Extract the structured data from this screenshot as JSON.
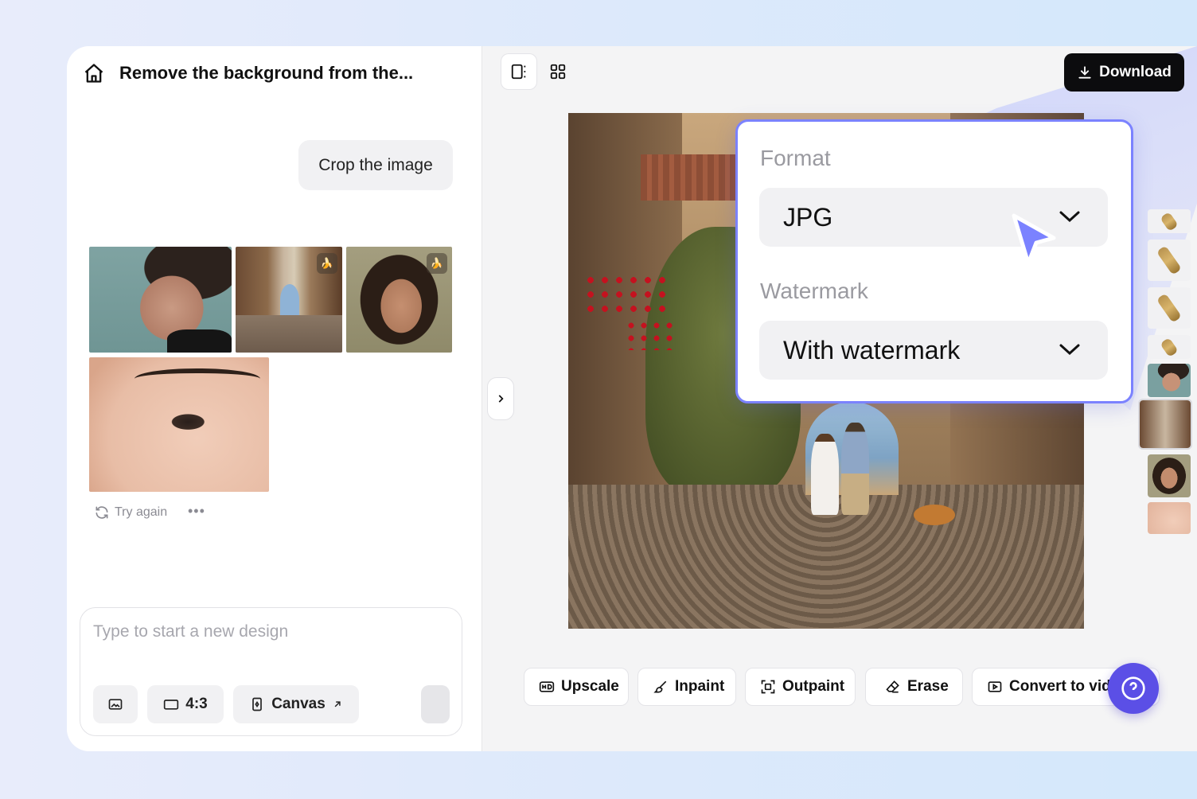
{
  "left_panel": {
    "title": "Remove the background from the...",
    "prompt_bubble": "Crop the image",
    "try_again": "Try again",
    "more": "•••",
    "composer": {
      "placeholder": "Type to start a new design",
      "ratio_label": "4:3",
      "canvas_label": "Canvas"
    }
  },
  "toolbar": {
    "download_label": "Download"
  },
  "download_popup": {
    "format_label": "Format",
    "format_value": "JPG",
    "watermark_label": "Watermark",
    "watermark_value": "With watermark"
  },
  "tools": [
    {
      "label": "Upscale",
      "icon": "hd-icon"
    },
    {
      "label": "Inpaint",
      "icon": "brush-icon"
    },
    {
      "label": "Outpaint",
      "icon": "expand-icon"
    },
    {
      "label": "Erase",
      "icon": "eraser-icon"
    },
    {
      "label": "Convert to vid",
      "icon": "video-icon"
    }
  ],
  "colors": {
    "accent": "#7b82ff",
    "help_button": "#5b4fe6",
    "download_bg": "#0c0c0e"
  }
}
